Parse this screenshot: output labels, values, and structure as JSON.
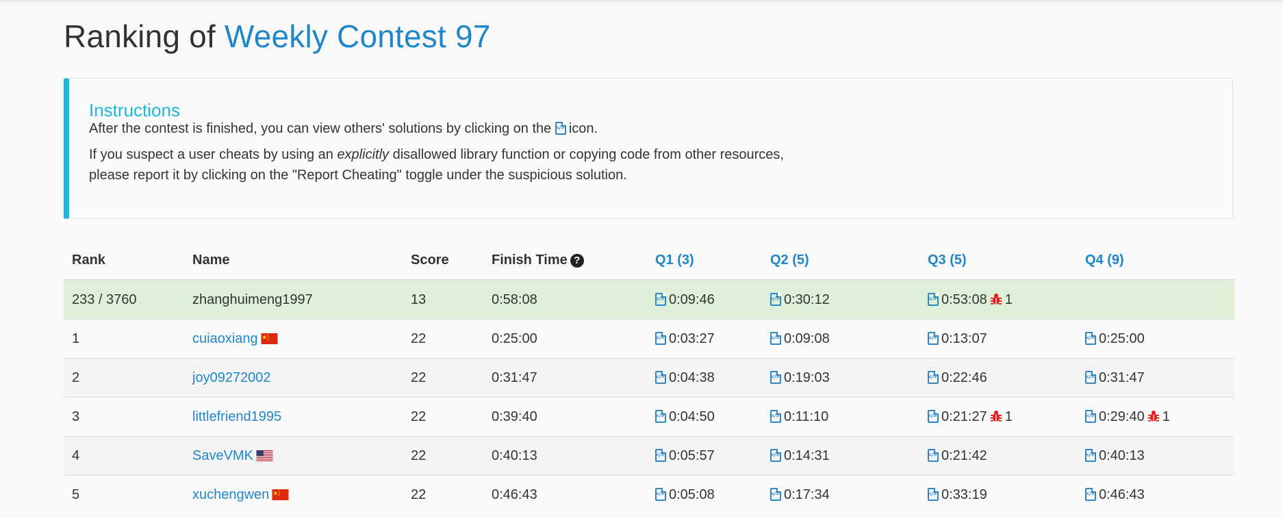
{
  "page": {
    "title_prefix": "Ranking of",
    "contest_name": "Weekly Contest 97"
  },
  "instructions": {
    "heading": "Instructions",
    "line1_before_icon": "After the contest is finished, you can view others' solutions by clicking on the",
    "line1_after_icon": "icon.",
    "line2_part1": "If you suspect a user cheats by using an",
    "line2_emphasis": "explicitly",
    "line2_part2": "disallowed library function or copying code from other resources,",
    "line3": "please report it by clicking on the \"Report Cheating\" toggle under the suspicious solution."
  },
  "table": {
    "headers": {
      "rank": "Rank",
      "name": "Name",
      "score": "Score",
      "finish_time": "Finish Time",
      "q1": "Q1 (3)",
      "q2": "Q2 (5)",
      "q3": "Q3 (5)",
      "q4": "Q4 (9)"
    },
    "rows": [
      {
        "rank": "233 / 3760",
        "name": "zhanghuimeng1997",
        "flag": "",
        "score": "13",
        "finish": "0:58:08",
        "q1": "0:09:46",
        "q1_bugs": "",
        "q2": "0:30:12",
        "q2_bugs": "",
        "q3": "0:53:08",
        "q3_bugs": "1",
        "q4": "",
        "q4_bugs": ""
      },
      {
        "rank": "1",
        "name": "cuiaoxiang",
        "flag": "china-flag",
        "score": "22",
        "finish": "0:25:00",
        "q1": "0:03:27",
        "q1_bugs": "",
        "q2": "0:09:08",
        "q2_bugs": "",
        "q3": "0:13:07",
        "q3_bugs": "",
        "q4": "0:25:00",
        "q4_bugs": ""
      },
      {
        "rank": "2",
        "name": "joy09272002",
        "flag": "",
        "score": "22",
        "finish": "0:31:47",
        "q1": "0:04:38",
        "q1_bugs": "",
        "q2": "0:19:03",
        "q2_bugs": "",
        "q3": "0:22:46",
        "q3_bugs": "",
        "q4": "0:31:47",
        "q4_bugs": ""
      },
      {
        "rank": "3",
        "name": "littlefriend1995",
        "flag": "",
        "score": "22",
        "finish": "0:39:40",
        "q1": "0:04:50",
        "q1_bugs": "",
        "q2": "0:11:10",
        "q2_bugs": "",
        "q3": "0:21:27",
        "q3_bugs": "1",
        "q4": "0:29:40",
        "q4_bugs": "1"
      },
      {
        "rank": "4",
        "name": "SaveVMK",
        "flag": "us-flag",
        "score": "22",
        "finish": "0:40:13",
        "q1": "0:05:57",
        "q1_bugs": "",
        "q2": "0:14:31",
        "q2_bugs": "",
        "q3": "0:21:42",
        "q3_bugs": "",
        "q4": "0:40:13",
        "q4_bugs": ""
      },
      {
        "rank": "5",
        "name": "xuchengwen",
        "flag": "china-flag",
        "score": "22",
        "finish": "0:46:43",
        "q1": "0:05:08",
        "q1_bugs": "",
        "q2": "0:17:34",
        "q2_bugs": "",
        "q3": "0:33:19",
        "q3_bugs": "",
        "q4": "0:46:43",
        "q4_bugs": ""
      }
    ]
  },
  "colors": {
    "link": "#1f87c8",
    "accent": "#1ab8d6",
    "my_row": "#dff0d8",
    "bug": "#e02020"
  }
}
